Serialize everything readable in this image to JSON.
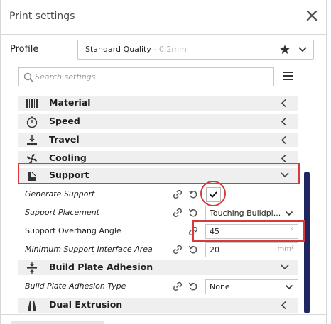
{
  "window": {
    "title": "Print settings"
  },
  "profile": {
    "label": "Profile",
    "name": "Standard Quality",
    "detail": " - 0.2mm"
  },
  "search": {
    "placeholder": "Search settings"
  },
  "categories": {
    "material": "Material",
    "speed": "Speed",
    "travel": "Travel",
    "cooling": "Cooling",
    "support": "Support",
    "adhesion": "Build Plate Adhesion",
    "dual": "Dual Extrusion"
  },
  "settings": {
    "generate_support": {
      "label": "Generate Support",
      "checked": true
    },
    "support_placement": {
      "label": "Support Placement",
      "value": "Touching Buildpl..."
    },
    "overhang_angle": {
      "label": "Support Overhang Angle",
      "value": "45",
      "unit": "°"
    },
    "interface_area": {
      "label": "Minimum Support Interface Area",
      "value": "20",
      "unit": "mm²"
    },
    "adhesion_type": {
      "label": "Build Plate Adhesion Type",
      "value": "None"
    }
  },
  "colors": {
    "highlight": "#d63a3a",
    "scrollbar": "#1f2660",
    "category_bg": "#efefef"
  }
}
